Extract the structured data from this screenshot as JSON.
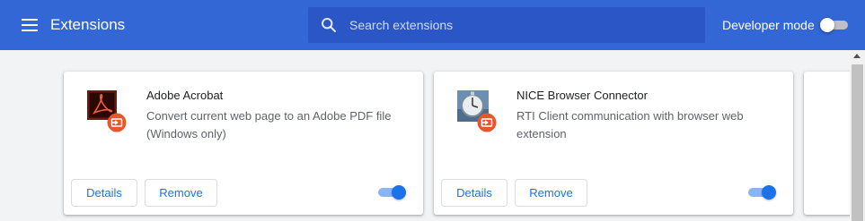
{
  "header": {
    "title": "Extensions",
    "search_placeholder": "Search extensions",
    "dev_mode_label": "Developer mode",
    "dev_mode_enabled": false
  },
  "extensions": [
    {
      "name": "Adobe Acrobat",
      "description": "Convert current web page to an Adobe PDF file (Windows only)",
      "icon": "adobe-acrobat-icon",
      "details_label": "Details",
      "remove_label": "Remove",
      "enabled": true
    },
    {
      "name": "NICE Browser Connector",
      "description": "RTI Client communication with browser web extension",
      "icon": "stopwatch-icon",
      "details_label": "Details",
      "remove_label": "Remove",
      "enabled": true
    }
  ],
  "colors": {
    "header_bg": "#3367d6",
    "search_bg": "#2a56c6",
    "accent": "#1a73e8",
    "badge": "#e8552c"
  }
}
